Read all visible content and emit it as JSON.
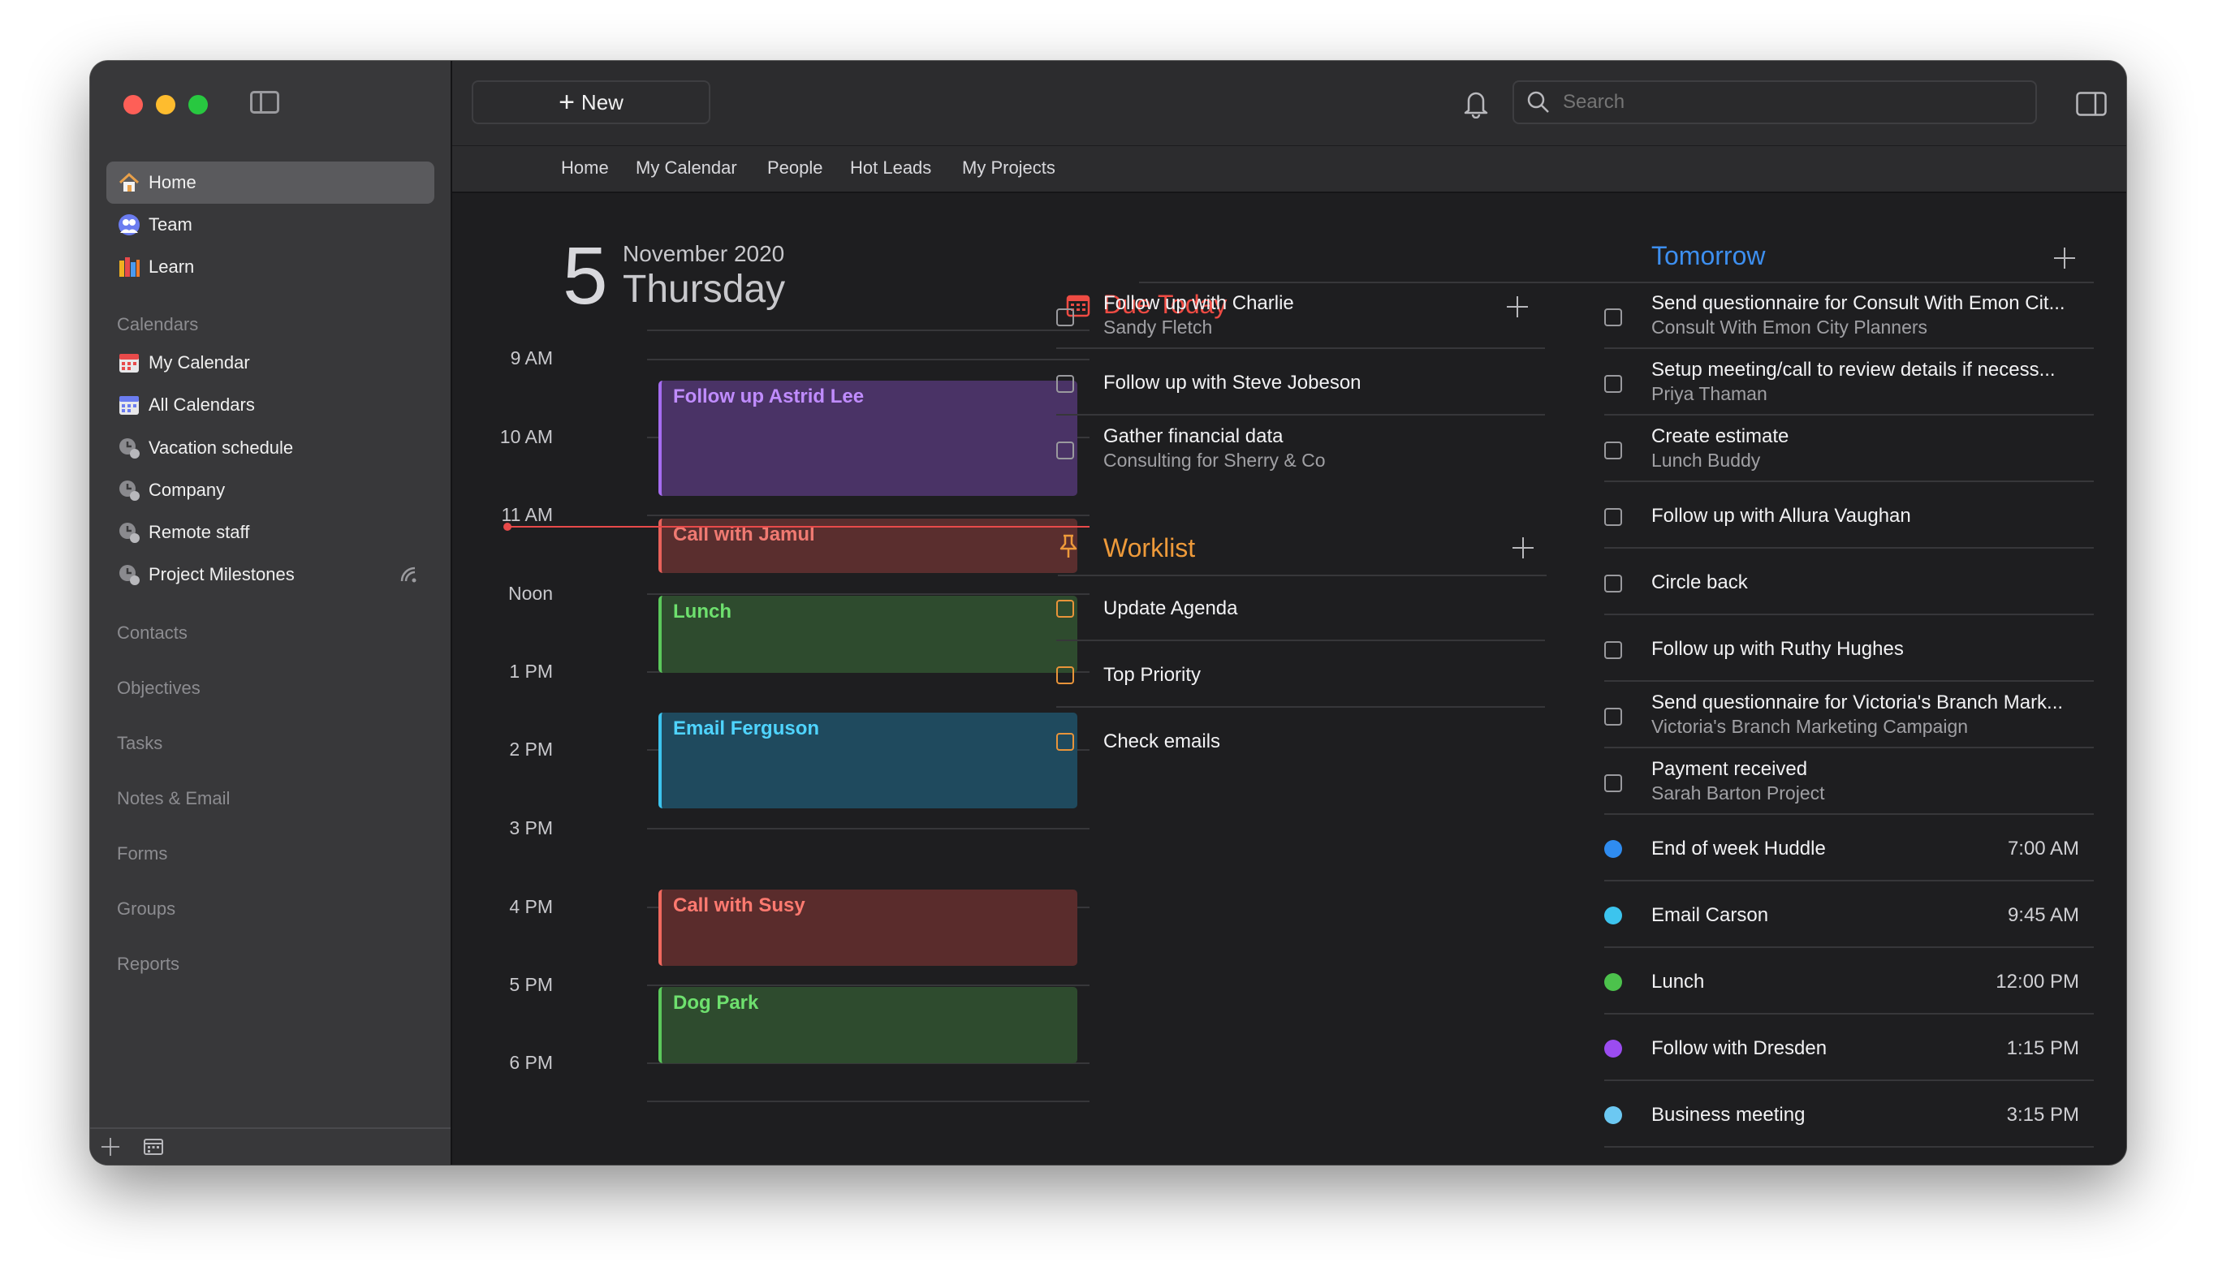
{
  "sidebar": {
    "nav": [
      {
        "label": "Home",
        "icon": "house-icon"
      },
      {
        "label": "Team",
        "icon": "team-icon"
      },
      {
        "label": "Learn",
        "icon": "books-icon"
      }
    ],
    "calendars_heading": "Calendars",
    "calendars": [
      {
        "label": "My Calendar",
        "icon": "calendar-icon"
      },
      {
        "label": "All Calendars",
        "icon": "calendar-icon"
      },
      {
        "label": "Vacation schedule",
        "icon": "shared-calendar-icon"
      },
      {
        "label": "Company",
        "icon": "shared-calendar-icon"
      },
      {
        "label": "Remote staff",
        "icon": "shared-calendar-icon"
      },
      {
        "label": "Project Milestones",
        "icon": "shared-calendar-icon"
      }
    ],
    "sections": [
      "Contacts",
      "Objectives",
      "Tasks",
      "Notes & Email",
      "Forms",
      "Groups",
      "Reports"
    ]
  },
  "toolbar": {
    "new_label": "New",
    "search_placeholder": "Search"
  },
  "tabs": [
    "Home",
    "My Calendar",
    "People",
    "Hot Leads",
    "My Projects"
  ],
  "day": {
    "number": "5",
    "month_year": "November 2020",
    "weekday": "Thursday"
  },
  "hours": [
    "9 AM",
    "10 AM",
    "11 AM",
    "Noon",
    "1 PM",
    "2 PM",
    "3 PM",
    "4 PM",
    "5 PM",
    "6 PM"
  ],
  "events": [
    {
      "title": "Follow up Astrid Lee",
      "color": "#a56cf0"
    },
    {
      "title": "Call with Jamul",
      "color": "#e8615a"
    },
    {
      "title": "Lunch",
      "color": "#5bc85b"
    },
    {
      "title": "Email Ferguson",
      "color": "#3cc4ee"
    },
    {
      "title": "Call with Susy",
      "color": "#f0685e"
    },
    {
      "title": "Dog Park",
      "color": "#5bc85b"
    }
  ],
  "due_today": {
    "title": "Due Today",
    "color": "#ee4b43",
    "items": [
      {
        "title": "Follow up with Charlie",
        "subtitle": "Sandy Fletch"
      },
      {
        "title": "Follow up with Steve Jobeson",
        "subtitle": ""
      },
      {
        "title": "Gather financial data",
        "subtitle": "Consulting for Sherry & Co"
      }
    ]
  },
  "worklist": {
    "title": "Worklist",
    "color": "#ee9a3a",
    "items": [
      {
        "title": "Update Agenda"
      },
      {
        "title": "Top Priority"
      },
      {
        "title": "Check emails"
      }
    ]
  },
  "tomorrow": {
    "title": "Tomorrow",
    "color": "#3d8ff0",
    "tasks": [
      {
        "title": "Send questionnaire for Consult With Emon Cit...",
        "subtitle": "Consult With Emon City Planners"
      },
      {
        "title": "Setup meeting/call to review details if necess...",
        "subtitle": "Priya Thaman"
      },
      {
        "title": "Create estimate",
        "subtitle": "Lunch Buddy"
      },
      {
        "title": "Follow up with Allura Vaughan",
        "subtitle": ""
      },
      {
        "title": "Circle back",
        "subtitle": ""
      },
      {
        "title": "Follow up with Ruthy Hughes",
        "subtitle": ""
      },
      {
        "title": "Send questionnaire for Victoria's Branch Mark...",
        "subtitle": "Victoria's Branch Marketing Campaign"
      },
      {
        "title": "Payment received",
        "subtitle": "Sarah Barton Project"
      }
    ],
    "events": [
      {
        "title": "End of week Huddle",
        "time": "7:00 AM",
        "color": "#2f8cf0"
      },
      {
        "title": "Email Carson",
        "time": "9:45 AM",
        "color": "#3cc4ee"
      },
      {
        "title": "Lunch",
        "time": "12:00 PM",
        "color": "#4cc24c"
      },
      {
        "title": "Follow with Dresden",
        "time": "1:15 PM",
        "color": "#9b4cf0"
      },
      {
        "title": "Business meeting",
        "time": "3:15 PM",
        "color": "#6cc8f2"
      }
    ]
  }
}
